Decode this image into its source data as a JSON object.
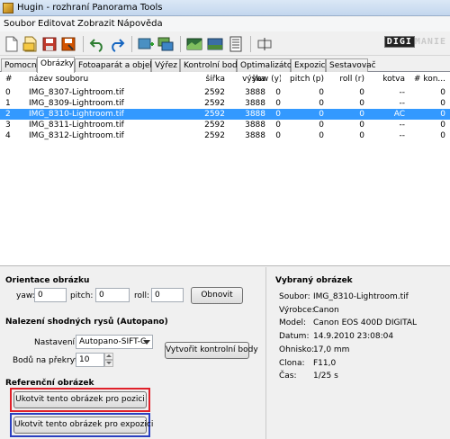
{
  "window": {
    "title": "Hugin - rozhraní Panorama Tools"
  },
  "menu": [
    "Soubor",
    "Editovat",
    "Zobrazit",
    "Nápověda"
  ],
  "logo": {
    "part1": "DIGI",
    "part2": "MANIE"
  },
  "tabs": [
    "Pomocník",
    "Obrázky",
    "Fotoaparát a objektiv",
    "Výřez",
    "Kontrolní body",
    "Optimalizátor",
    "Expozice",
    "Sestavovač"
  ],
  "active_tab": "Obrázky",
  "table": {
    "columns": [
      "#",
      "název souboru",
      "šířka",
      "výška",
      "yaw (y)",
      "pitch (p)",
      "roll (r)",
      "kotva",
      "# kon..."
    ],
    "rows": [
      {
        "num": "0",
        "file": "IMG_8307-Lightroom.tif",
        "width": "2592",
        "height": "3888",
        "yaw": "0",
        "pitch": "0",
        "roll": "0",
        "anchor": "--",
        "cp": "0"
      },
      {
        "num": "1",
        "file": "IMG_8309-Lightroom.tif",
        "width": "2592",
        "height": "3888",
        "yaw": "0",
        "pitch": "0",
        "roll": "0",
        "anchor": "--",
        "cp": "0"
      },
      {
        "num": "2",
        "file": "IMG_8310-Lightroom.tif",
        "width": "2592",
        "height": "3888",
        "yaw": "0",
        "pitch": "0",
        "roll": "0",
        "anchor": "AC",
        "cp": "0"
      },
      {
        "num": "3",
        "file": "IMG_8311-Lightroom.tif",
        "width": "2592",
        "height": "3888",
        "yaw": "0",
        "pitch": "0",
        "roll": "0",
        "anchor": "--",
        "cp": "0"
      },
      {
        "num": "4",
        "file": "IMG_8312-Lightroom.tif",
        "width": "2592",
        "height": "3888",
        "yaw": "0",
        "pitch": "0",
        "roll": "0",
        "anchor": "--",
        "cp": "0"
      }
    ],
    "selected_row": 2
  },
  "orientation": {
    "title": "Orientace obrázku",
    "yaw_label": "yaw:",
    "yaw_value": "0",
    "pitch_label": "pitch:",
    "pitch_value": "0",
    "roll_label": "roll:",
    "roll_value": "0",
    "reset_button": "Obnovit"
  },
  "feature_matching": {
    "title": "Nalezení shodných rysů (Autopano)",
    "settings_label": "Nastavení:",
    "settings_value": "Autopano-SIFT-C",
    "points_label": "Bodů na překryti:",
    "points_value": "10",
    "create_button": "Vytvořit kontrolní body"
  },
  "reference": {
    "title": "Referenční obrázek",
    "anchor_position_button": "Ukotvit tento obrázek pro pozici",
    "anchor_exposure_button": "Ukotvit tento obrázek pro expozici"
  },
  "selected_image": {
    "title": "Vybraný obrázek",
    "fields": [
      {
        "label": "Soubor:",
        "value": "IMG_8310-Lightroom.tif"
      },
      {
        "label": "Výrobce:",
        "value": "Canon"
      },
      {
        "label": "Model:",
        "value": "Canon EOS 400D DIGITAL"
      },
      {
        "label": "Datum:",
        "value": "14.9.2010 23:08:04"
      },
      {
        "label": "Ohnisko:",
        "value": "17,0 mm"
      },
      {
        "label": "Clona:",
        "value": "F11,0"
      },
      {
        "label": "Čas:",
        "value": "1/25 s"
      }
    ]
  },
  "colors": {
    "selection": "#3399ff",
    "highlight_red": "#e0202a",
    "highlight_blue": "#2a3fc0"
  }
}
